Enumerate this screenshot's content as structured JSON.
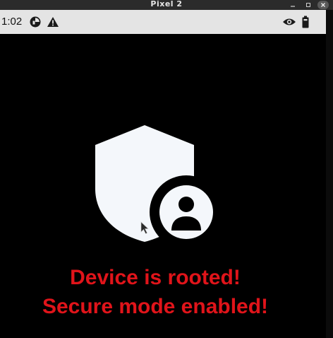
{
  "window": {
    "title": "Pixel 2"
  },
  "status_bar": {
    "time": "1:02",
    "left_icons": [
      "notification-badge-icon",
      "warning-icon"
    ],
    "right_icons": [
      "eye-icon",
      "battery-icon"
    ]
  },
  "main": {
    "icon": "shield-user-icon",
    "message_line1": "Device is rooted!",
    "message_line2": "Secure mode enabled!"
  },
  "colors": {
    "background": "#000000",
    "message": "#e0141a",
    "status_bar_bg": "#e4e4e4",
    "title_bar_bg": "#2b2b2b"
  }
}
